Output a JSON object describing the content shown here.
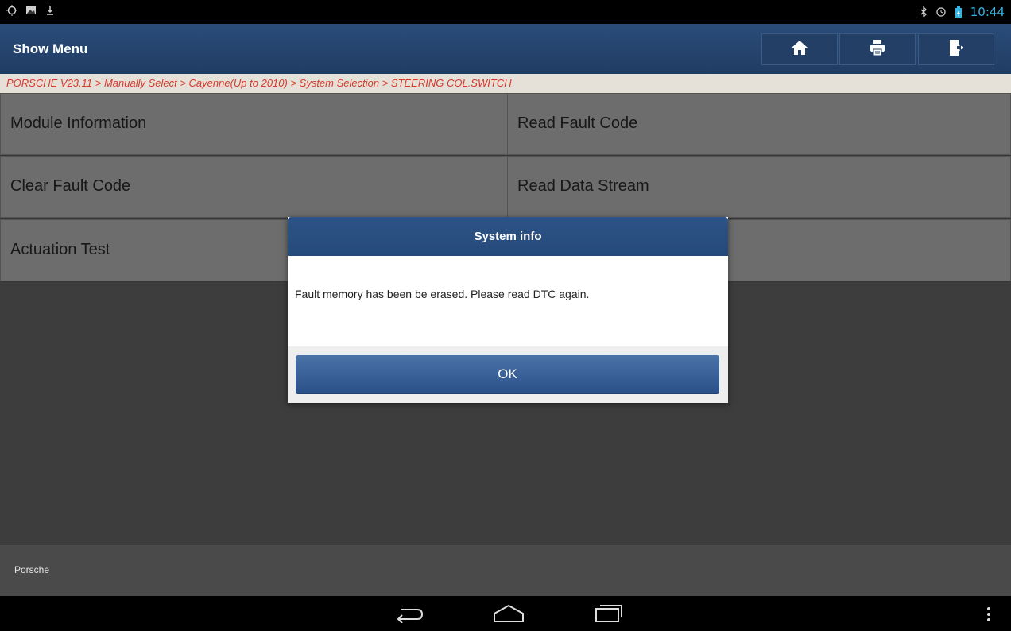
{
  "status_bar": {
    "left_icons": [
      "gps-icon",
      "image-icon",
      "download-icon"
    ],
    "right_icons": [
      "bluetooth-icon",
      "alarm-icon",
      "battery-icon"
    ],
    "time": "10:44"
  },
  "header": {
    "title": "Show Menu",
    "buttons": [
      "home-icon",
      "print-icon",
      "exit-icon"
    ]
  },
  "breadcrumb": "PORSCHE V23.11 > Manually Select > Cayenne(Up to 2010) > System Selection > STEERING COL.SWITCH",
  "menu": {
    "items": [
      "Module Information",
      "Read Fault Code",
      "Clear Fault Code",
      "Read Data Stream",
      "Actuation Test",
      ""
    ]
  },
  "footer": {
    "label": "Porsche"
  },
  "dialog": {
    "title": "System info",
    "message": "Fault memory has been be erased. Please read DTC again.",
    "ok_label": "OK"
  },
  "navbar": {
    "icons": [
      "back-icon",
      "home-nav-icon",
      "recents-icon",
      "overflow-menu-icon"
    ]
  },
  "colors": {
    "header": "#203d63",
    "breadcrumb_text": "#d8392b",
    "time": "#33b5e5"
  }
}
